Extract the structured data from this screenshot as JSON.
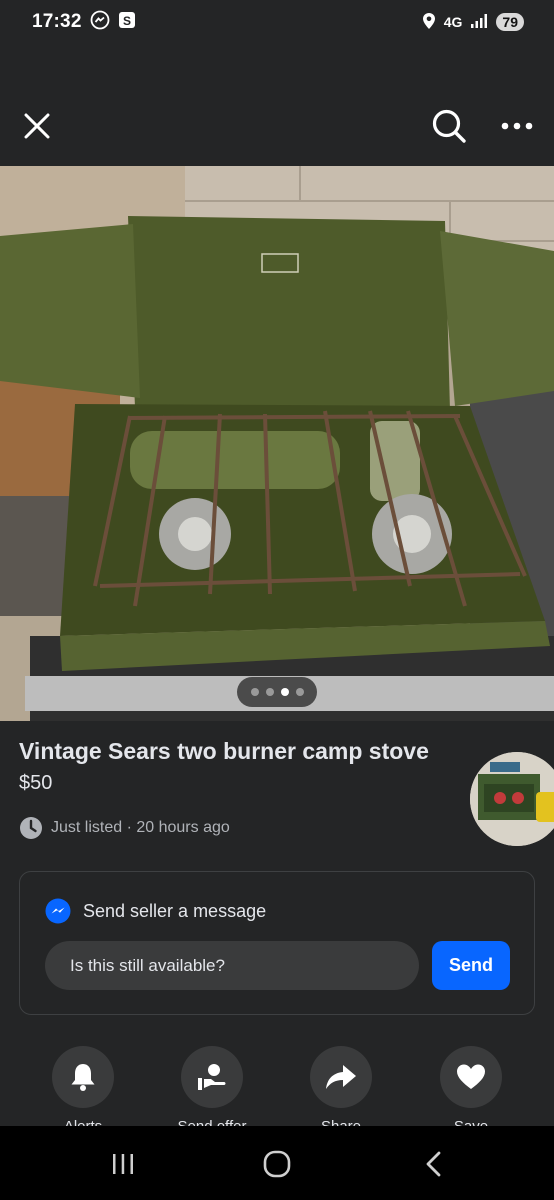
{
  "status_bar": {
    "time": "17:32",
    "network": "4G",
    "battery": "79"
  },
  "top_nav": {
    "close_icon": "close-icon",
    "search_icon": "search-icon",
    "more_icon": "more-icon"
  },
  "listing": {
    "title": "Vintage Sears two burner camp stove",
    "price": "$50",
    "listed_text": "Just listed · 20 hours ago",
    "photo_index": 3,
    "photo_count": 4
  },
  "message": {
    "header": "Send seller a message",
    "input_value": "Is this still available?",
    "send_label": "Send"
  },
  "actions": [
    {
      "label": "Alerts",
      "icon": "bell-icon"
    },
    {
      "label": "Send offer",
      "icon": "offer-icon"
    },
    {
      "label": "Share",
      "icon": "share-icon"
    },
    {
      "label": "Save",
      "icon": "heart-icon"
    }
  ],
  "colors": {
    "background": "#242526",
    "accent": "#0866ff",
    "button_bg": "#3a3b3c"
  }
}
